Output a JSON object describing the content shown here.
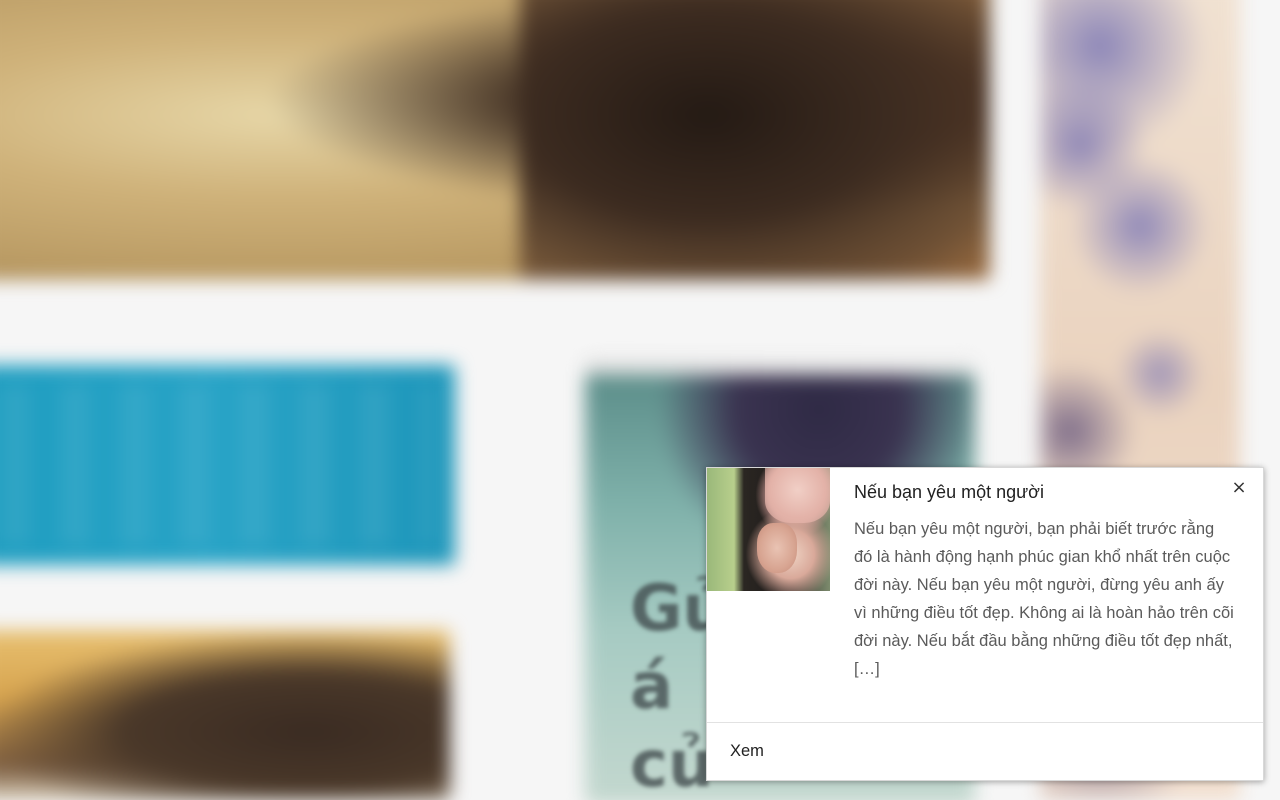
{
  "notification": {
    "title": "Nếu bạn yêu một người",
    "body": "Nếu bạn yêu một người, bạn phải biết trước rằng đó là hành động hạnh phúc gian khổ nhất trên cuộc đời này. Nếu bạn yêu một người, đừng yêu anh ấy vì những điều tốt đẹp. Không ai là hoàn hảo trên cõi đời này. Nếu bắt đầu bằng những điều tốt đẹp nhất, […]",
    "close_icon": "×",
    "action_label": "Xem",
    "thumbnail_icon": "photo-thumbnail"
  },
  "background": {
    "center_tile_text": "Gử\ná\ncủ",
    "colors": {
      "page": "#f6f6f6",
      "blue_tile": "#1e9dc0",
      "notification_bg": "#ffffff",
      "title_text": "#212121",
      "body_text": "#5a5a5a"
    }
  }
}
